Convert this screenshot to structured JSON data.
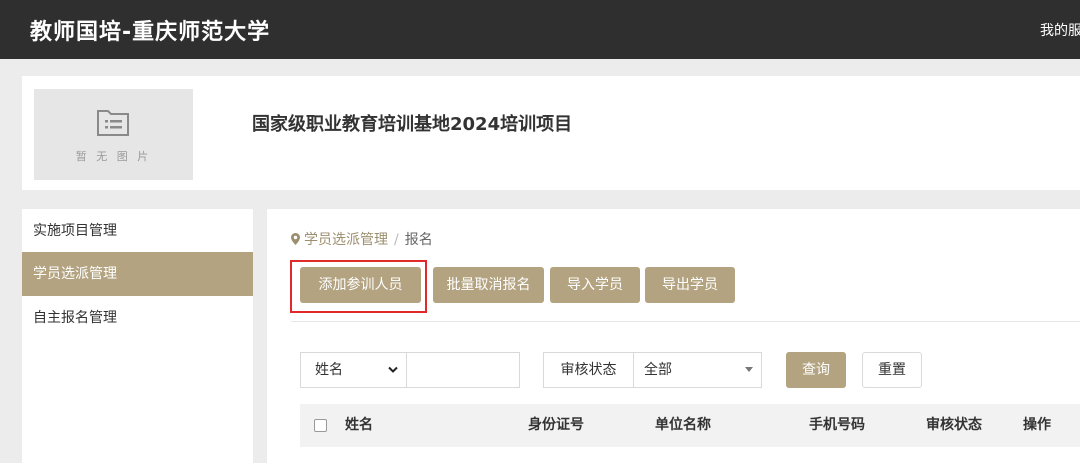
{
  "header": {
    "site_title": "教师国培-重庆师范大学",
    "user_link": "我的服务"
  },
  "project": {
    "thumbnail_text": "暂 无 图 片",
    "thumbnail_icon": "file-list-icon",
    "title": "国家级职业教育培训基地2024培训项目"
  },
  "sidebar": {
    "items": [
      {
        "label": "实施项目管理"
      },
      {
        "label": "学员选派管理"
      },
      {
        "label": "自主报名管理"
      }
    ],
    "active_index": 1
  },
  "breadcrumb": {
    "parent": "学员选派管理",
    "separator": "/",
    "current": "报名"
  },
  "toolbar": {
    "add_label": "添加参训人员",
    "batch_cancel_label": "批量取消报名",
    "import_label": "导入学员",
    "export_label": "导出学员"
  },
  "filter": {
    "field_select_value": "姓名",
    "search_value": "",
    "status_label": "审核状态",
    "status_select_value": "全部",
    "query_label": "查询",
    "reset_label": "重置"
  },
  "table": {
    "columns": [
      "姓名",
      "身份证号",
      "单位名称",
      "手机号码",
      "审核状态",
      "操作"
    ]
  },
  "colors": {
    "topbar": "#2f2f2f",
    "accent": "#b3a380",
    "highlight": "#e02a2a"
  }
}
